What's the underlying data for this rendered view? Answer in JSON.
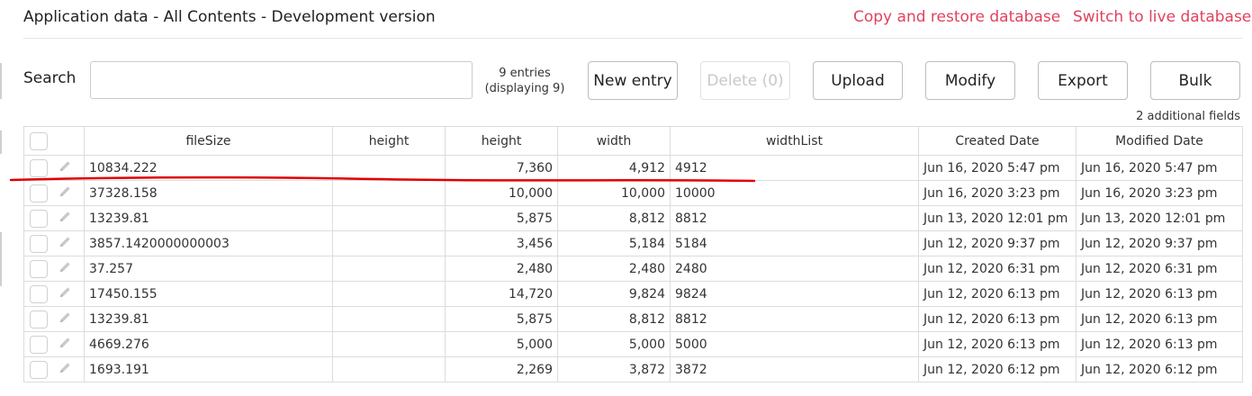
{
  "header": {
    "title": "Application data - All Contents - Development version",
    "copy_restore_link": "Copy and restore database",
    "switch_live_link": "Switch to live database"
  },
  "toolbar": {
    "search_label": "Search",
    "search_value": "",
    "entries_count": "9 entries",
    "entries_displaying": "(displaying 9)",
    "new_entry": "New entry",
    "delete": "Delete (0)",
    "upload": "Upload",
    "modify": "Modify",
    "export": "Export",
    "bulk": "Bulk",
    "additional_fields": "2 additional fields"
  },
  "colors": {
    "link": "#e0425e",
    "annotation": "#e00000"
  },
  "table": {
    "columns": [
      "fileSize",
      "height",
      "height",
      "width",
      "widthList",
      "Created Date",
      "Modified Date"
    ],
    "rows": [
      {
        "fileSize": "10834.222",
        "height_a": "",
        "height": "7,360",
        "width": "4,912",
        "widthList": "4912",
        "created": "Jun 16, 2020 5:47 pm",
        "modified": "Jun 16, 2020 5:47 pm"
      },
      {
        "fileSize": "37328.158",
        "height_a": "",
        "height": "10,000",
        "width": "10,000",
        "widthList": "10000",
        "created": "Jun 16, 2020 3:23 pm",
        "modified": "Jun 16, 2020 3:23 pm"
      },
      {
        "fileSize": "13239.81",
        "height_a": "",
        "height": "5,875",
        "width": "8,812",
        "widthList": "8812",
        "created": "Jun 13, 2020 12:01 pm",
        "modified": "Jun 13, 2020 12:01 pm"
      },
      {
        "fileSize": "3857.1420000000003",
        "height_a": "",
        "height": "3,456",
        "width": "5,184",
        "widthList": "5184",
        "created": "Jun 12, 2020 9:37 pm",
        "modified": "Jun 12, 2020 9:37 pm"
      },
      {
        "fileSize": "37.257",
        "height_a": "",
        "height": "2,480",
        "width": "2,480",
        "widthList": "2480",
        "created": "Jun 12, 2020 6:31 pm",
        "modified": "Jun 12, 2020 6:31 pm"
      },
      {
        "fileSize": "17450.155",
        "height_a": "",
        "height": "14,720",
        "width": "9,824",
        "widthList": "9824",
        "created": "Jun 12, 2020 6:13 pm",
        "modified": "Jun 12, 2020 6:13 pm"
      },
      {
        "fileSize": "13239.81",
        "height_a": "",
        "height": "5,875",
        "width": "8,812",
        "widthList": "8812",
        "created": "Jun 12, 2020 6:13 pm",
        "modified": "Jun 12, 2020 6:13 pm"
      },
      {
        "fileSize": "4669.276",
        "height_a": "",
        "height": "5,000",
        "width": "5,000",
        "widthList": "5000",
        "created": "Jun 12, 2020 6:13 pm",
        "modified": "Jun 12, 2020 6:13 pm"
      },
      {
        "fileSize": "1693.191",
        "height_a": "",
        "height": "2,269",
        "width": "3,872",
        "widthList": "3872",
        "created": "Jun 12, 2020 6:12 pm",
        "modified": "Jun 12, 2020 6:12 pm"
      }
    ]
  }
}
